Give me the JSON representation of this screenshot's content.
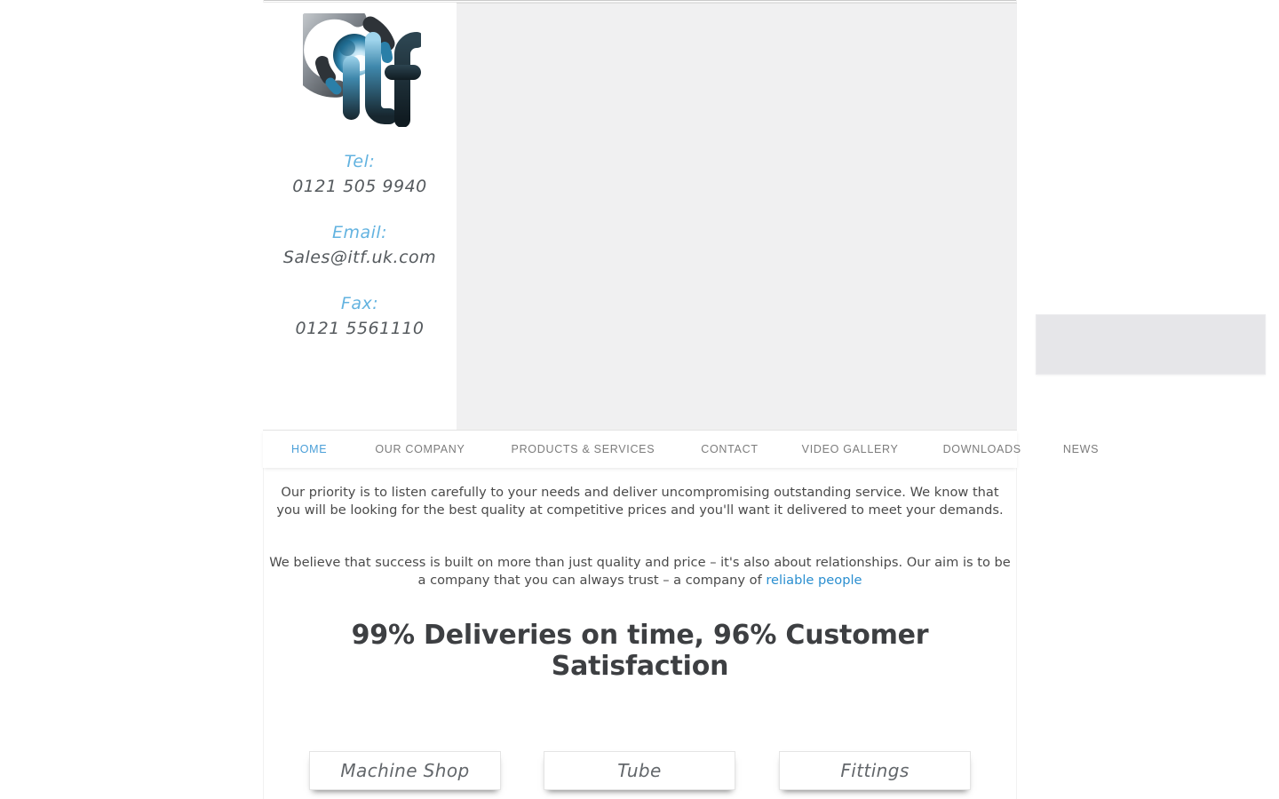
{
  "brand": {
    "logo_icon": "itf-logo",
    "logo_text": "itf"
  },
  "contact": {
    "tel_label": "Tel:",
    "tel_value": "0121 505 9940",
    "email_label": "Email:",
    "email_value": "Sales@itf.uk.com",
    "fax_label": "Fax:",
    "fax_value": "0121 5561110"
  },
  "nav": {
    "items": [
      {
        "label": "HOME",
        "active": true
      },
      {
        "label": "OUR COMPANY",
        "active": false
      },
      {
        "label": "PRODUCTS & SERVICES",
        "active": false
      },
      {
        "label": "CONTACT",
        "active": false
      },
      {
        "label": "VIDEO GALLERY",
        "active": false
      },
      {
        "label": "DOWNLOADS",
        "active": false
      },
      {
        "label": "NEWS",
        "active": false
      }
    ]
  },
  "main": {
    "paragraph_1": "Our priority is to listen carefully to your needs and deliver uncompromising outstanding service. We know that you will be looking for the best quality at competitive prices and you'll want it delivered to meet your demands.",
    "paragraph_2_before": "We believe that success is built on more than just quality and price – it's also about relationships. Our aim is to be a company that you can always trust – a company of ",
    "paragraph_2_link": "reliable people",
    "headline": "99% Deliveries on time, 96% Customer Satisfaction"
  },
  "categories": [
    {
      "label": "Machine Shop"
    },
    {
      "label": "Tube"
    },
    {
      "label": "Fittings"
    }
  ],
  "colors": {
    "accent_blue": "#4a9fd8",
    "link_blue": "#2b8fd0",
    "label_blue": "#63b3e0",
    "body_text": "#4a4a4a",
    "nav_text": "#7c7c7c",
    "panel_grey": "#f0f0f1"
  }
}
